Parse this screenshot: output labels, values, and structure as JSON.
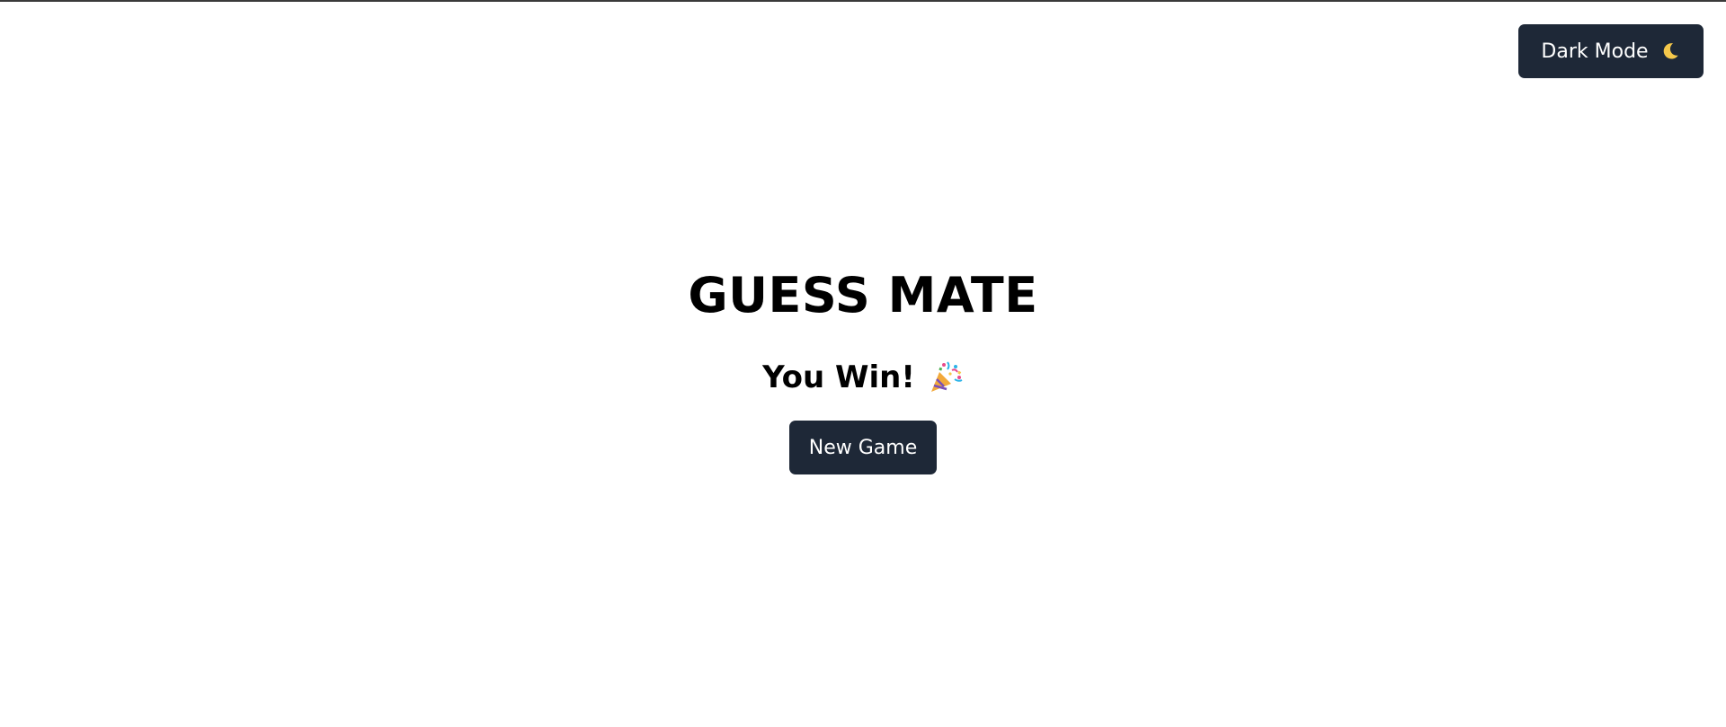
{
  "header": {
    "theme_toggle_label": "Dark Mode",
    "theme_toggle_icon": "moon-icon"
  },
  "main": {
    "title": "GUESS MATE",
    "result_text": "You Win!",
    "result_icon": "party-popper-icon",
    "new_game_label": "New Game"
  },
  "colors": {
    "button_bg": "#1e2837",
    "button_text": "#ffffff",
    "moon": "#f5c84b",
    "background": "#ffffff"
  }
}
